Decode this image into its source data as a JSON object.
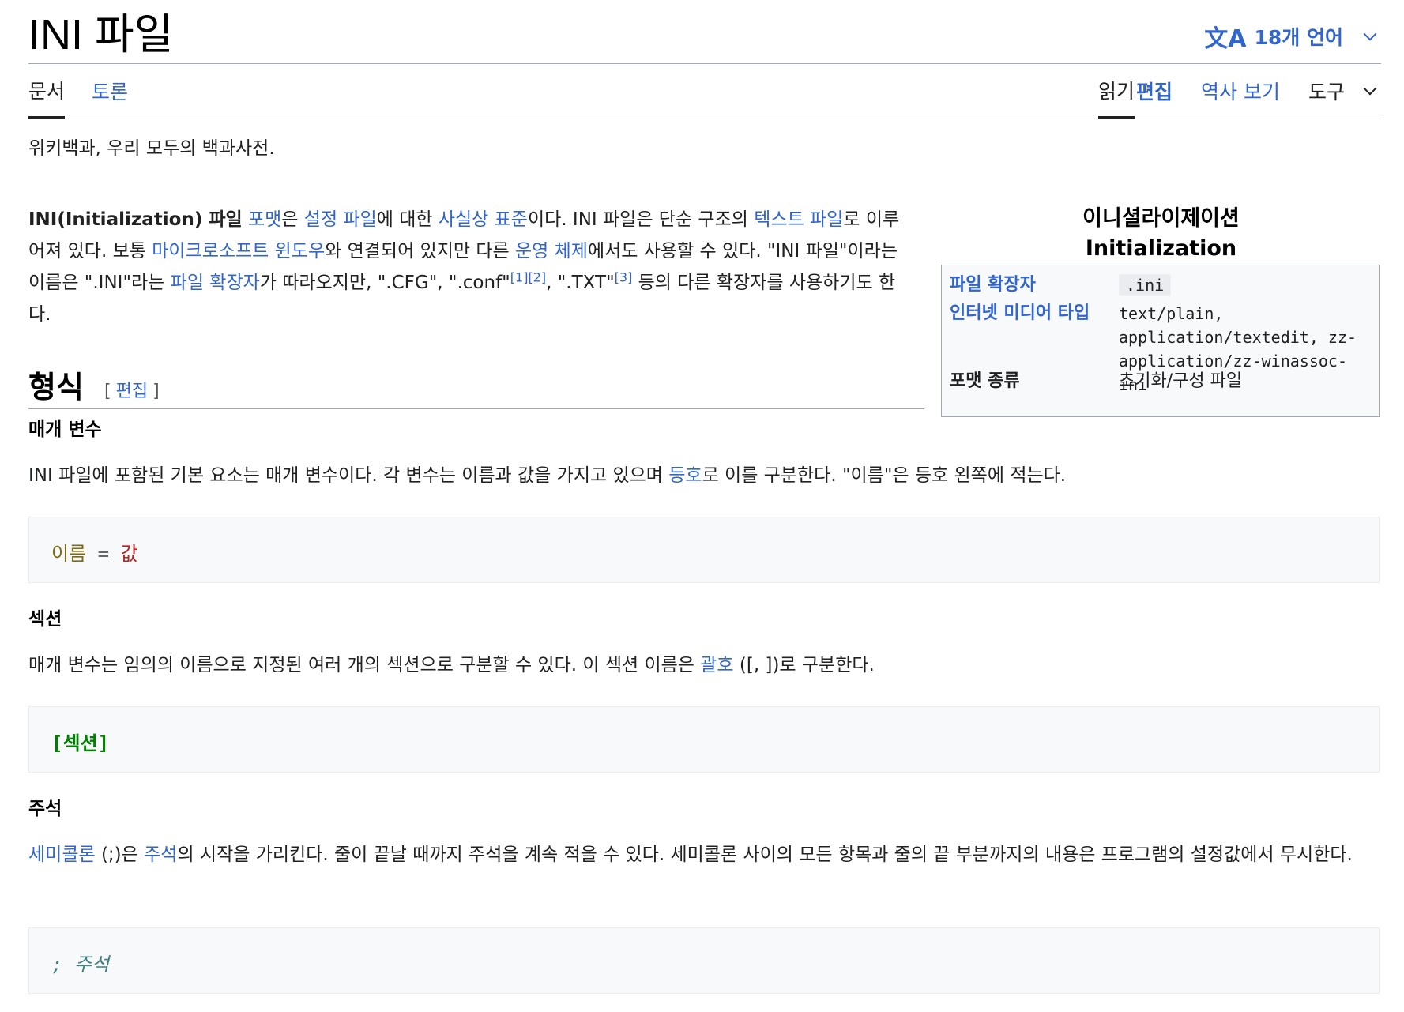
{
  "page": {
    "title": "INI 파일",
    "languages_label": "18개 언어",
    "tagline": "위키백과, 우리 모두의 백과사전."
  },
  "tabs": {
    "article": "문서",
    "talk": "토론",
    "read": "읽기",
    "edit": "편집",
    "history": "역사 보기",
    "tools": "도구"
  },
  "intro": {
    "parts": [
      {
        "text": "INI(Initialization) 파일",
        "style": "bold"
      },
      {
        "text": " "
      },
      {
        "text": "포맷",
        "style": "link"
      },
      {
        "text": "은 "
      },
      {
        "text": "설정 파일",
        "style": "link"
      },
      {
        "text": "에 대한 "
      },
      {
        "text": "사실상 표준",
        "style": "link"
      },
      {
        "text": "이다. INI 파일은 단순 구조의 "
      },
      {
        "text": "텍스트 파일",
        "style": "link"
      },
      {
        "text": "로 이루어져 있다. 보통 "
      },
      {
        "text": "마이크로소프트 윈도우",
        "style": "link"
      },
      {
        "text": "와 연결되어 있지만 다른 "
      },
      {
        "text": "운영 체제",
        "style": "link"
      },
      {
        "text": "에서도 사용할 수 있다. \"INI 파일\"이라는 이름은 \".INI\"라는 "
      },
      {
        "text": "파일 확장자",
        "style": "link"
      },
      {
        "text": "가 따라오지만, \".CFG\", \".conf\""
      },
      {
        "text": "[1]",
        "style": "sup"
      },
      {
        "text": "[2]",
        "style": "sup"
      },
      {
        "text": ", \".TXT\""
      },
      {
        "text": "[3]",
        "style": "sup"
      },
      {
        "text": " 등의 다른 확장자를 사용하기도 한다."
      }
    ]
  },
  "infobox": {
    "caption_ko": "이니셜라이제이션",
    "caption_en": "Initialization",
    "rows": [
      {
        "label": "파일 확장자",
        "value": ".ini"
      },
      {
        "label": "인터넷 미디어 타입",
        "value": "text/plain, application/textedit, zz-application/zz-winassoc-ini"
      },
      {
        "label": "포맷 종류",
        "value": "초기화/구성 파일"
      }
    ]
  },
  "section": {
    "heading": "형식",
    "edit_label": "편집",
    "bracket_open": "[",
    "bracket_close": "]"
  },
  "params": {
    "heading": "매개 변수",
    "text_before": "INI 파일에 포함된 기본 요소는 매개 변수이다. 각 변수는 이름과 값을 가지고 있으며 ",
    "link": "등호",
    "text_after": "로 이를 구분한다. \"이름\"은 등호 왼쪽에 적는다.",
    "code_name": "이름",
    "code_eq": " = ",
    "code_val": "값"
  },
  "sections": {
    "heading": "섹션",
    "text_before": "매개 변수는 임의의 이름으로 지정된 여러 개의 섹션으로 구분할 수 있다. 이 섹션 이름은 ",
    "link": "괄호",
    "text_after": " ([, ])로 구분한다.",
    "code": "[섹션]"
  },
  "comments": {
    "heading": "주석",
    "link1": "세미콜론",
    "text1": " (;)은 ",
    "link2": "주석",
    "text2": "의 시작을 가리킨다. 줄이 끝날 때까지 주석을 계속 적을 수 있다. 세미콜론 사이의 모든 항목과 줄의 끝 부분까지의 내용은 프로그램의 설정값에서 무시한다.",
    "code": "; 주석"
  },
  "colors": {
    "link": "#3366cc",
    "text": "#202122",
    "code_bg": "#f8f9fa"
  }
}
